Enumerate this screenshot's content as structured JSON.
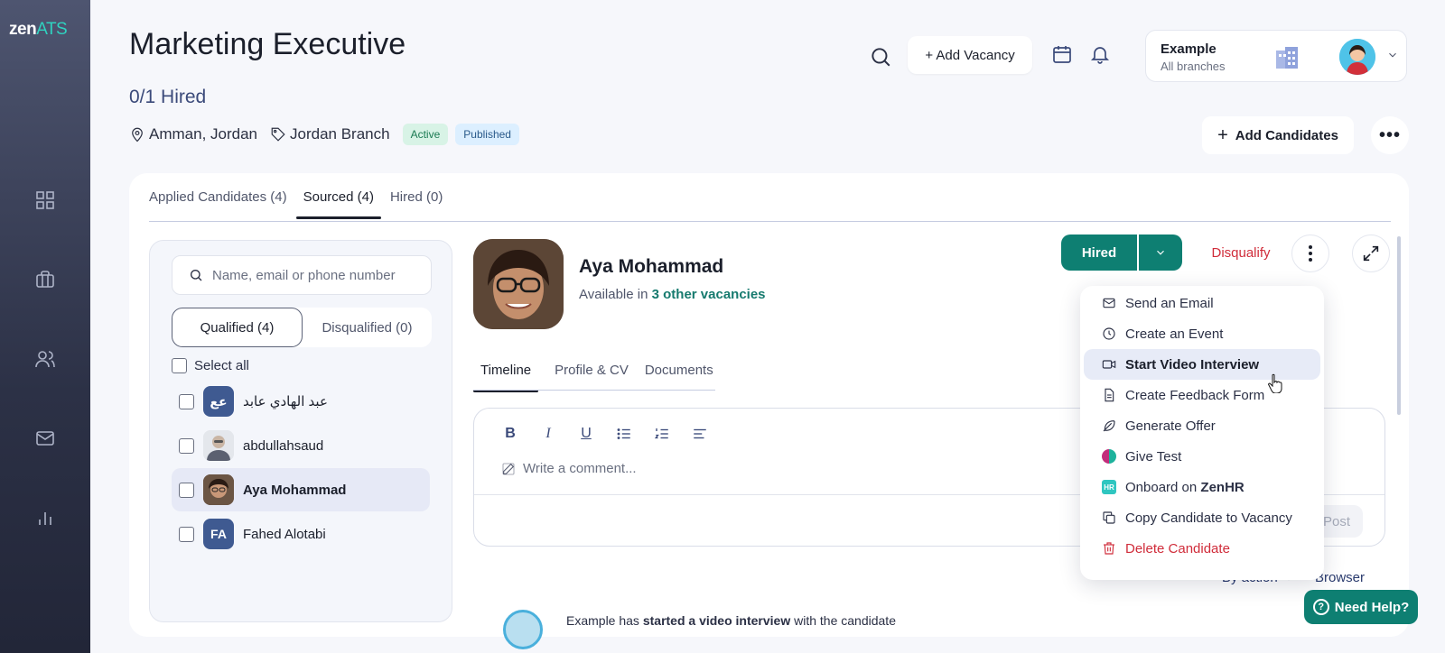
{
  "app": {
    "logo_main": "zen",
    "logo_accent": "ATS"
  },
  "sidebar": {
    "items": [
      {
        "name": "dashboard",
        "icon": "grid-icon"
      },
      {
        "name": "vacancies",
        "icon": "briefcase-icon"
      },
      {
        "name": "candidates",
        "icon": "users-icon"
      },
      {
        "name": "messages",
        "icon": "mail-icon"
      },
      {
        "name": "reports",
        "icon": "bar-chart-icon"
      }
    ]
  },
  "header": {
    "title": "Marketing Executive",
    "hired_count": "0/1 Hired",
    "location": "Amman, Jordan",
    "branch": "Jordan Branch",
    "status_active": "Active",
    "status_published": "Published",
    "add_vacancy_label": "+ Add Vacancy",
    "add_candidates_label": "Add Candidates"
  },
  "org": {
    "name": "Example",
    "sub": "All branches"
  },
  "tabs": [
    {
      "label": "Applied Candidates (4)"
    },
    {
      "label": "Sourced (4)",
      "active": true
    },
    {
      "label": "Hired (0)"
    }
  ],
  "list": {
    "search_placeholder": "Name, email or phone number",
    "seg_qualified": "Qualified (4)",
    "seg_disqualified": "Disqualified (0)",
    "select_all": "Select all",
    "candidates": [
      {
        "name": "عبد الهادي عابد",
        "initials": "عع"
      },
      {
        "name": "abdullahsaud",
        "initials": ""
      },
      {
        "name": "Aya Mohammad",
        "initials": "",
        "selected": true
      },
      {
        "name": "Fahed Alotabi",
        "initials": "FA"
      }
    ]
  },
  "profile": {
    "name": "Aya Mohammad",
    "avail_prefix": "Available in",
    "avail_link": "3 other vacancies",
    "hired_label": "Hired",
    "disqualify_label": "Disqualify",
    "sub_tabs": [
      {
        "label": "Timeline",
        "active": true
      },
      {
        "label": "Profile & CV"
      },
      {
        "label": "Documents"
      }
    ],
    "comment_placeholder": "Write a comment...",
    "post_label": "Post",
    "by_action": "By action",
    "browser_frag": "Browser",
    "timeline_entry_prefix": "Example has ",
    "timeline_entry_bold": "started a video interview",
    "timeline_entry_suffix": " with the candidate"
  },
  "dropdown": {
    "items": [
      {
        "label": "Send an Email",
        "icon": "mail-icon"
      },
      {
        "label": "Create an Event",
        "icon": "clock-icon"
      },
      {
        "label": "Start Video Interview",
        "icon": "video-icon",
        "hover": true
      },
      {
        "label": "Create Feedback Form",
        "icon": "document-icon"
      },
      {
        "label": "Generate Offer",
        "icon": "feather-icon"
      },
      {
        "label": "Give Test",
        "icon": "test-icon"
      },
      {
        "label_prefix": "Onboard on ",
        "label_bold": "ZenHR",
        "icon": "zenhr-icon"
      },
      {
        "label": "Copy Candidate to Vacancy",
        "icon": "copy-icon"
      },
      {
        "label": "Delete Candidate",
        "icon": "trash-icon",
        "danger": true
      }
    ]
  },
  "help": {
    "label": "Need Help?"
  },
  "colors": {
    "brand_teal": "#0e7f72",
    "danger": "#d02c3a",
    "sidebar": "#2c3146",
    "accent_logo": "#2fd3c0"
  }
}
